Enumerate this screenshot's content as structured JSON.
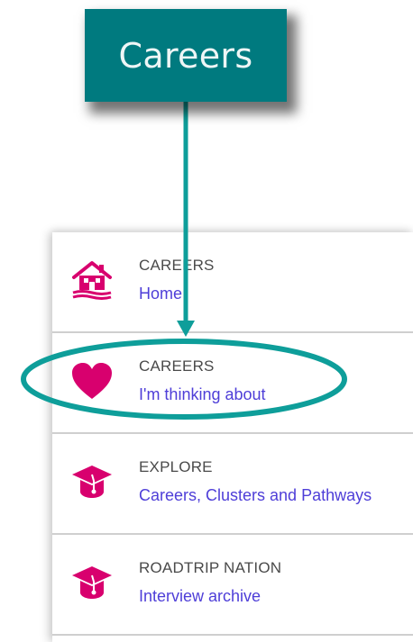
{
  "callout": {
    "label": "Careers"
  },
  "menu": {
    "items": [
      {
        "title": "CAREERS",
        "subtitle": "Home",
        "icon": "home-icon"
      },
      {
        "title": "CAREERS",
        "subtitle": "I'm thinking about",
        "icon": "heart-icon"
      },
      {
        "title": "EXPLORE",
        "subtitle": "Careers, Clusters and Pathways",
        "icon": "graduation-cap-icon"
      },
      {
        "title": "ROADTRIP NATION",
        "subtitle": "Interview archive",
        "icon": "graduation-cap-icon"
      }
    ]
  },
  "colors": {
    "callout_bg": "#007a7f",
    "annotation": "#0e9e9a",
    "icon": "#d8006e",
    "subtitle": "#4e3ed8",
    "divider": "#cfcfcf"
  }
}
